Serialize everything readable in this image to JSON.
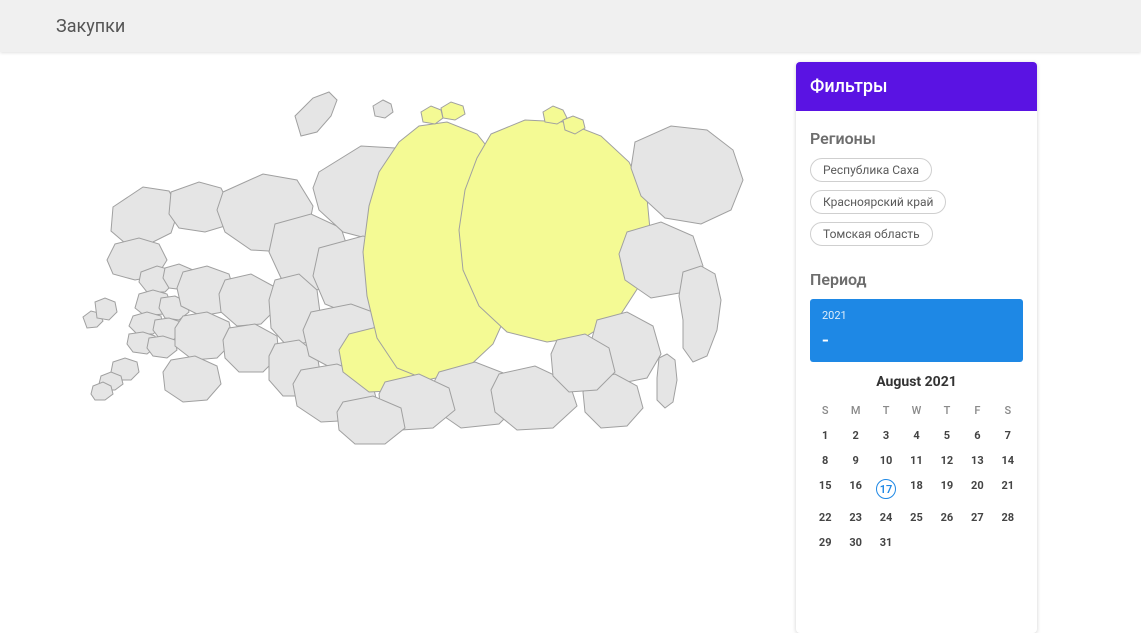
{
  "header": {
    "title": "Закупки"
  },
  "filters": {
    "title": "Фильтры",
    "regions": {
      "label": "Регионы",
      "items": [
        {
          "label": "Республика Саха"
        },
        {
          "label": "Красноярский край"
        },
        {
          "label": "Томская область"
        }
      ]
    },
    "period": {
      "label": "Период",
      "year": "2021",
      "range": "-"
    }
  },
  "calendar": {
    "title": "August 2021",
    "dow": [
      "S",
      "M",
      "T",
      "W",
      "T",
      "F",
      "S"
    ],
    "days": [
      "1",
      "2",
      "3",
      "4",
      "5",
      "6",
      "7",
      "8",
      "9",
      "10",
      "11",
      "12",
      "13",
      "14",
      "15",
      "16",
      "17",
      "18",
      "19",
      "20",
      "21",
      "22",
      "23",
      "24",
      "25",
      "26",
      "27",
      "28",
      "29",
      "30",
      "31"
    ],
    "today": "17"
  }
}
